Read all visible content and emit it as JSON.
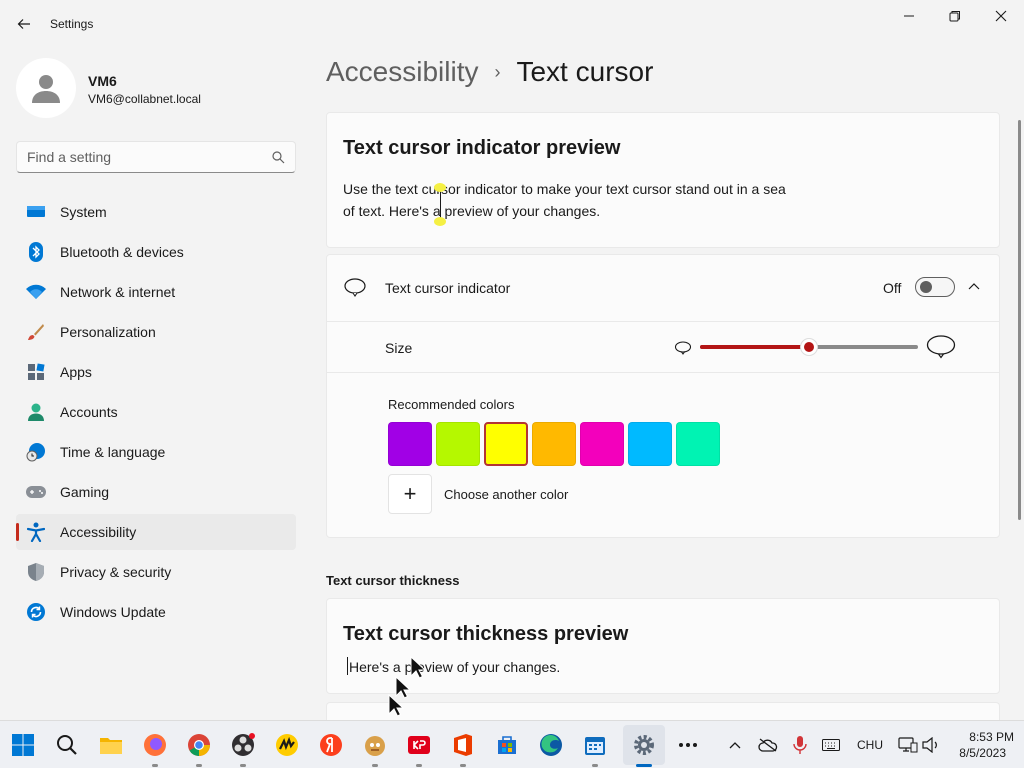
{
  "app": {
    "title": "Settings"
  },
  "user": {
    "name": "VM6",
    "email": "VM6@collabnet.local"
  },
  "search": {
    "placeholder": "Find a setting"
  },
  "nav": {
    "items": [
      {
        "label": "System",
        "icon": "monitor-icon"
      },
      {
        "label": "Bluetooth & devices",
        "icon": "bluetooth-icon"
      },
      {
        "label": "Network & internet",
        "icon": "wifi-icon"
      },
      {
        "label": "Personalization",
        "icon": "brush-icon"
      },
      {
        "label": "Apps",
        "icon": "apps-icon"
      },
      {
        "label": "Accounts",
        "icon": "person-icon"
      },
      {
        "label": "Time & language",
        "icon": "globe-clock-icon"
      },
      {
        "label": "Gaming",
        "icon": "gamepad-icon"
      },
      {
        "label": "Accessibility",
        "icon": "accessibility-icon"
      },
      {
        "label": "Privacy & security",
        "icon": "shield-icon"
      },
      {
        "label": "Windows Update",
        "icon": "update-icon"
      }
    ],
    "active": "Accessibility"
  },
  "breadcrumb": {
    "parent": "Accessibility",
    "separator": "›",
    "current": "Text cursor"
  },
  "preview": {
    "title": "Text cursor indicator preview",
    "text_line1": "Use the text cursor indicator to make your text cursor stand out in a sea",
    "text_line2": "of text. Here's a preview of your changes."
  },
  "indicator": {
    "label": "Text cursor indicator",
    "state": "Off",
    "enabled": false
  },
  "size": {
    "label": "Size",
    "value_fraction": 0.5
  },
  "colors": {
    "label": "Recommended colors",
    "swatches": [
      "#a100e6",
      "#b5f800",
      "#ffff00",
      "#ffb900",
      "#f300bc",
      "#00baff",
      "#00f3b3"
    ],
    "selected_index": 2,
    "choose_label": "Choose another color"
  },
  "thickness": {
    "section_label": "Text cursor thickness",
    "preview_title": "Text cursor thickness preview",
    "preview_text": "Here's a preview of your changes."
  },
  "accent": "#c42b1c",
  "taskbar": {
    "apps": [
      "start-icon",
      "search-icon",
      "file-explorer-icon",
      "firefox-icon",
      "chrome-icon",
      "obs-icon",
      "yandex-music-icon",
      "yandex-browser-icon",
      "tor-icon",
      "kaspersky-icon",
      "office-icon",
      "store-icon",
      "edge-icon",
      "calendar-icon",
      "settings-icon",
      "more-icon"
    ],
    "tray": {
      "language": "CHU",
      "time": "8:53 PM",
      "date": "8/5/2023"
    }
  }
}
